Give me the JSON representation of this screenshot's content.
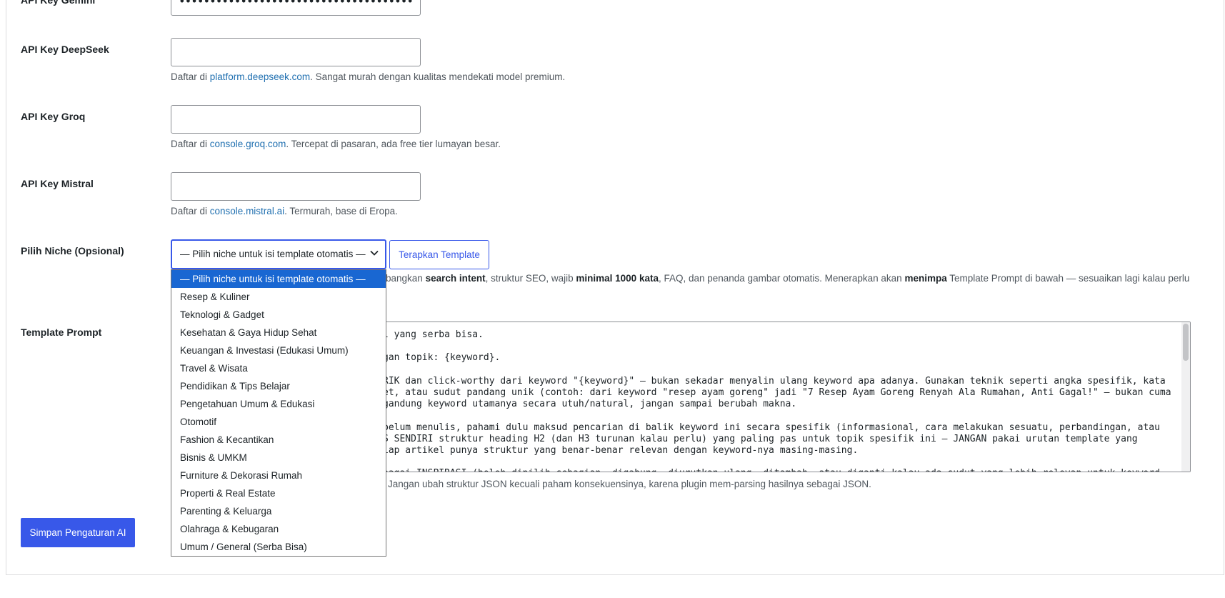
{
  "fields": {
    "gemini": {
      "label": "API Key Gemini",
      "value": "••••••••••••••••••••••••••••••••••••••"
    },
    "deepseek": {
      "label": "API Key DeepSeek",
      "desc_prefix": "Daftar di ",
      "link": "platform.deepseek.com",
      "desc_suffix": ". Sangat murah dengan kualitas mendekati model premium."
    },
    "groq": {
      "label": "API Key Groq",
      "desc_prefix": "Daftar di ",
      "link": "console.groq.com",
      "desc_suffix": ". Tercepat di pasaran, ada free tier lumayan besar."
    },
    "mistral": {
      "label": "API Key Mistral",
      "desc_prefix": "Daftar di ",
      "link": "console.mistral.ai",
      "desc_suffix": ". Termurah, base di Eropa."
    }
  },
  "niche": {
    "label": "Pilih Niche (Opsional)",
    "selected": "— Pilih niche untuk isi template otomatis —",
    "apply_button": "Terapkan Template",
    "desc_1": "bangkan ",
    "desc_b1": "search intent",
    "desc_2": ", struktur SEO, wajib ",
    "desc_b2": "minimal 1000 kata",
    "desc_3": ", FAQ, dan penanda gambar otomatis. Menerapkan akan ",
    "desc_b3": "menimpa",
    "desc_4": " Template Prompt di bawah — sesuaikan lagi kalau perlu",
    "options": [
      "— Pilih niche untuk isi template otomatis —",
      "Resep & Kuliner",
      "Teknologi & Gadget",
      "Kesehatan & Gaya Hidup Sehat",
      "Keuangan & Investasi (Edukasi Umum)",
      "Travel & Wisata",
      "Pendidikan & Tips Belajar",
      "Pengetahuan Umum & Edukasi",
      "Otomotif",
      "Fashion & Kecantikan",
      "Bisnis & UMKM",
      "Furniture & Dekorasi Rumah",
      "Properti & Real Estate",
      "Parenting & Keluarga",
      "Olahraga & Kebugaran",
      "Umum / General (Serba Bisa)"
    ]
  },
  "template": {
    "label": "Template Prompt",
    "visible_text": "l yang serba bisa.\n\ngan topik: {keyword}.\n\nRIK dan click-worthy dari keyword \"{keyword}\" — bukan sekadar menyalin ulang keyword apa adanya. Gunakan teknik seperti angka spesifik, kata\net, atau sudut pandang unik (contoh: dari keyword \"resep ayam goreng\" jadi \"7 Resep Ayam Goreng Renyah Ala Rumahan, Anti Gagal!\" — bukan cuma\ngandung keyword utamanya secara utuh/natural, jangan sampai berubah makna.\n\nbelum menulis, pahami dulu maksud pencarian di balik keyword ini secara spesifik (informasional, cara melakukan sesuatu, perbandingan, atau\nS SENDIRI struktur heading H2 (dan H3 turunan kalau perlu) yang paling pas untuk topik spesifik ini — JANGAN pakai urutan template yang\niap artikel punya struktur yang benar-benar relevan dengan keyword-nya masing-masing.\n\nbagai INSPIRASI (boleh dipilih sebagian, digabung, diurutkan ulang, ditambah, atau diganti kalau ada sudut yang lebih relevan untuk keyword",
    "note": "Jangan ubah struktur JSON kecuali paham konsekuensinya, karena plugin mem-parsing hasilnya sebagai JSON."
  },
  "save_button": "Simpan Pengaturan AI",
  "icons": {
    "select_arrow": "chevron-down-icon"
  },
  "colors": {
    "accent": "#3858e9",
    "link": "#2271b1",
    "option_highlight": "#1967d2"
  }
}
